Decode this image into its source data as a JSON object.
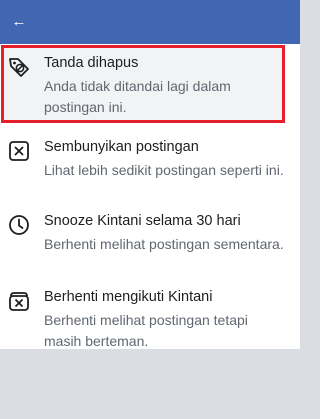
{
  "header": {
    "back_icon": "arrow-left-icon",
    "accent": "#4267b2"
  },
  "menu": {
    "items": [
      {
        "icon": "tag-removed-icon",
        "title": "Tanda dihapus",
        "subtitle": "Anda tidak ditandai lagi dalam postingan ini.",
        "highlight_color": "#e4202a"
      },
      {
        "icon": "close-box-icon",
        "title": "Sembunyikan postingan",
        "subtitle": "Lihat lebih sedikit postingan seperti ini."
      },
      {
        "icon": "clock-icon",
        "title": "Snooze Kintani selama 30 hari",
        "subtitle": "Berhenti melihat postingan sementara."
      },
      {
        "icon": "unfollow-icon",
        "title": "Berhenti mengikuti Kintani",
        "subtitle": "Berhenti melihat postingan tetapi masih berteman."
      }
    ]
  }
}
